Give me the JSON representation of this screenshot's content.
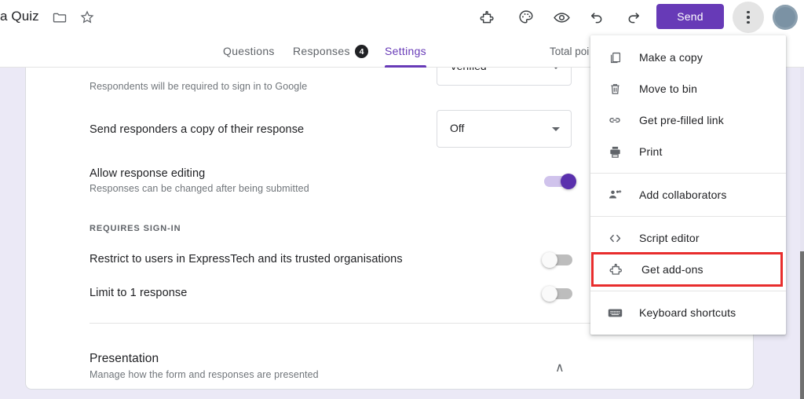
{
  "app": {
    "form_title": "a Quiz",
    "accent_color": "#673ab7",
    "highlight_color": "#e82d2d",
    "page_background": "#ebe9f6"
  },
  "topbar": {
    "folder_icon": "folder-icon",
    "star_icon": "star-icon",
    "tools": [
      {
        "name": "add-ons-icon",
        "icon": "puzzle-piece"
      },
      {
        "name": "theme-icon",
        "icon": "palette"
      },
      {
        "name": "preview-icon",
        "icon": "eye"
      },
      {
        "name": "undo-icon",
        "icon": "undo-arrow"
      },
      {
        "name": "redo-icon",
        "icon": "redo-arrow"
      }
    ],
    "send_label": "Send",
    "more_options_label": "More options",
    "avatar_label": "Account"
  },
  "tabs": [
    {
      "label": "Questions",
      "active": false
    },
    {
      "label": "Responses",
      "active": false,
      "badge": "4"
    },
    {
      "label": "Settings",
      "active": true
    }
  ],
  "total_points": "Total poi",
  "settings": {
    "sign_in_note": "Respondents will be required to sign in to Google",
    "collect_email_value": "Verified",
    "rows": [
      {
        "label": "Send responders a copy of their response",
        "control": "dropdown",
        "value": "Off"
      },
      {
        "label": "Allow response editing",
        "sub": "Responses can be changed after being submitted",
        "control": "toggle",
        "state": "on"
      }
    ],
    "requires_signin_caption": "REQUIRES SIGN-IN",
    "signin_rows": [
      {
        "label": "Restrict to users in ExpressTech and its trusted organisations",
        "control": "toggle",
        "state": "off"
      },
      {
        "label": "Limit to 1 response",
        "control": "toggle",
        "state": "off"
      }
    ],
    "presentation": {
      "title": "Presentation",
      "subtitle": "Manage how the form and responses are presented",
      "collapse_arrow": "∧"
    }
  },
  "menu": {
    "items": [
      {
        "label": "Make a copy",
        "icon": "copy-icon",
        "highlighted": false
      },
      {
        "label": "Move to bin",
        "icon": "trash-icon",
        "highlighted": false
      },
      {
        "label": "Get pre-filled link",
        "icon": "link-icon",
        "highlighted": false
      },
      {
        "label": "Print",
        "icon": "printer-icon",
        "highlighted": false
      },
      {
        "separator": true
      },
      {
        "label": "Add collaborators",
        "icon": "add-person-icon",
        "highlighted": false
      },
      {
        "separator": true
      },
      {
        "label": "Script editor",
        "icon": "code-icon",
        "highlighted": false
      },
      {
        "label": "Get add-ons",
        "icon": "puzzle-icon",
        "highlighted": true
      },
      {
        "separator": true
      },
      {
        "label": "Keyboard shortcuts",
        "icon": "keyboard-icon",
        "highlighted": false
      }
    ]
  }
}
